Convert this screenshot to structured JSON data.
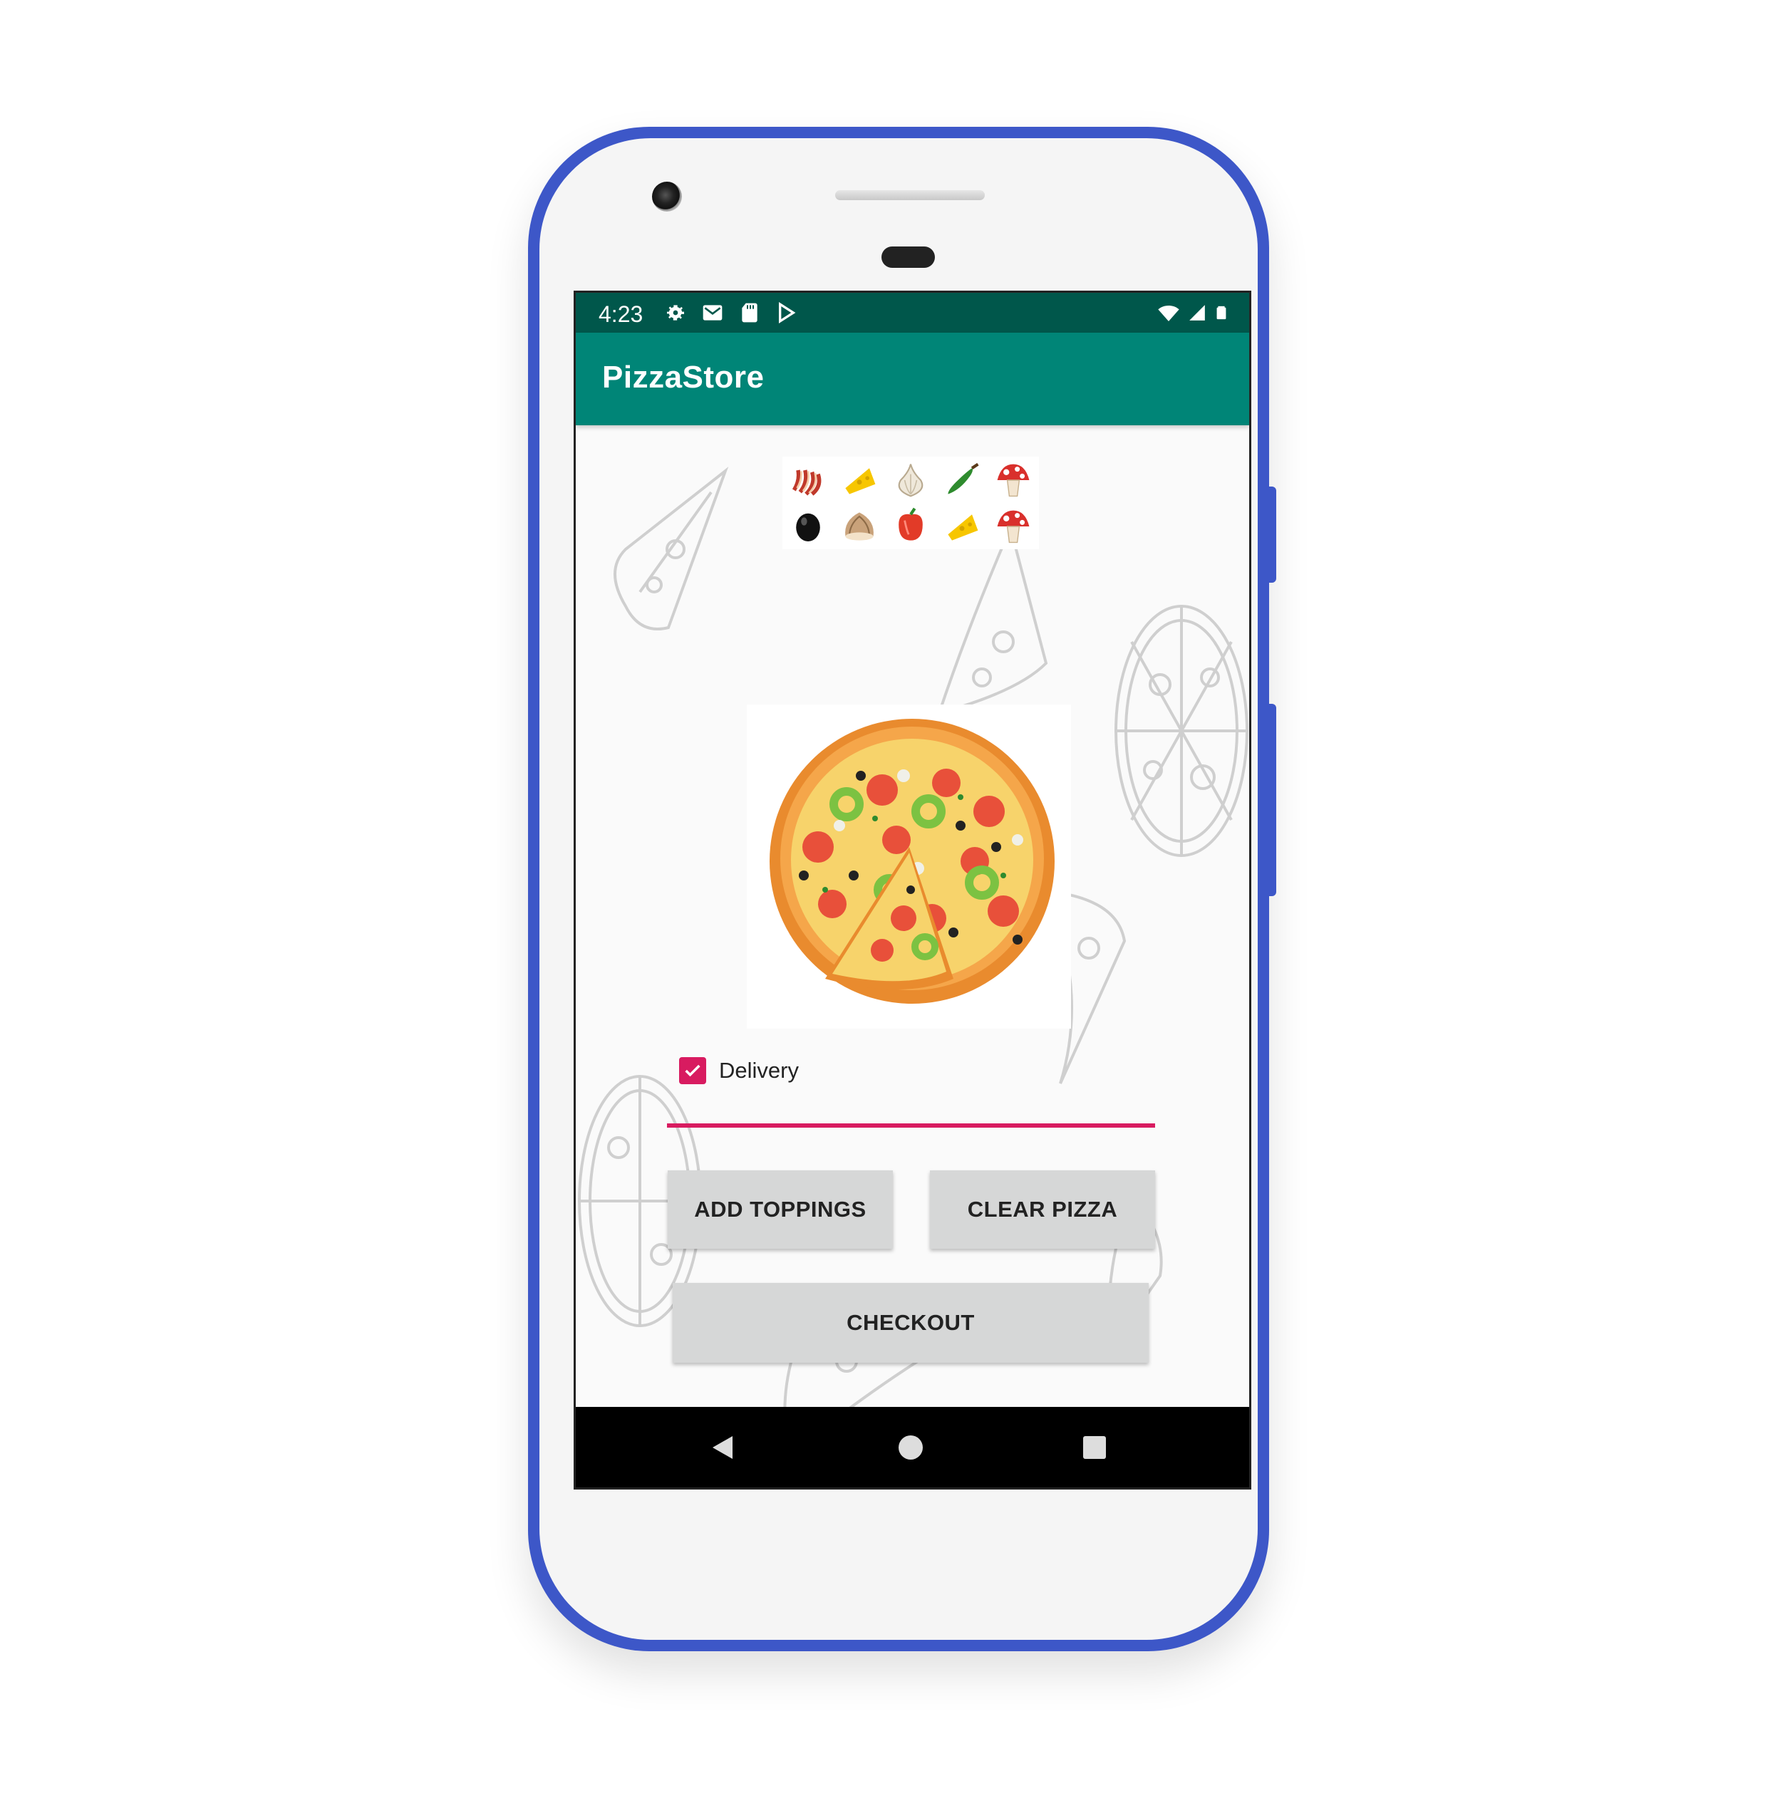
{
  "status_bar": {
    "time": "4:23",
    "background": "#00574b"
  },
  "app_bar": {
    "title": "PizzaStore",
    "background": "#008577"
  },
  "toppings": [
    "bacon-icon",
    "cheese-icon",
    "garlic-icon",
    "jalapeno-icon",
    "mushroom-icon",
    "olive-icon",
    "onion-icon",
    "red-pepper-icon",
    "cheese-icon",
    "mushroom-icon"
  ],
  "delivery": {
    "label": "Delivery",
    "checked": true,
    "accent": "#d81b60"
  },
  "buttons": {
    "add_toppings": "ADD TOPPINGS",
    "clear_pizza": "CLEAR PIZZA",
    "checkout": "CHECKOUT"
  },
  "nav_bar": {
    "back": "back-icon",
    "home": "home-icon",
    "recents": "recents-icon"
  }
}
